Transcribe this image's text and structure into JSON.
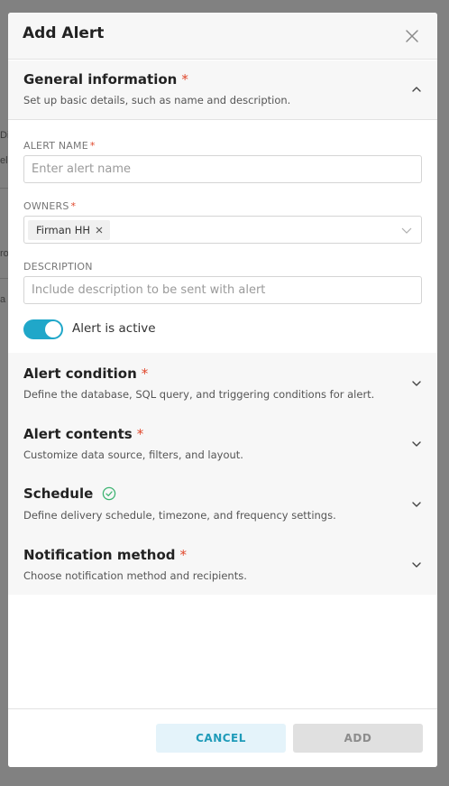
{
  "modal": {
    "title": "Add Alert",
    "close_icon": "close-icon"
  },
  "sections": {
    "general": {
      "title": "General information",
      "required_mark": "*",
      "subtitle": "Set up basic details, such as name and description.",
      "expanded": true
    },
    "condition": {
      "title": "Alert condition",
      "required_mark": "*",
      "subtitle": "Define the database, SQL query, and triggering conditions for alert."
    },
    "contents": {
      "title": "Alert contents",
      "required_mark": "*",
      "subtitle": "Customize data source, filters, and layout."
    },
    "schedule": {
      "title": "Schedule",
      "status_icon": "check-circle-icon",
      "subtitle": "Define delivery schedule, timezone, and frequency settings."
    },
    "notification": {
      "title": "Notification method",
      "required_mark": "*",
      "subtitle": "Choose notification method and recipients."
    }
  },
  "fields": {
    "alert_name": {
      "label": "ALERT NAME",
      "required_mark": "*",
      "value": "",
      "placeholder": "Enter alert name"
    },
    "owners": {
      "label": "OWNERS",
      "required_mark": "*",
      "selected": [
        "Firman HH"
      ]
    },
    "description": {
      "label": "DESCRIPTION",
      "value": "",
      "placeholder": "Include description to be sent with alert"
    },
    "active_toggle": {
      "label": "Alert is active",
      "on": true
    }
  },
  "footer": {
    "cancel_label": "CANCEL",
    "add_label": "ADD"
  },
  "background_fragments": [
    "Dil",
    "ele",
    "ro",
    "a"
  ],
  "colors": {
    "accent": "#20a7c9",
    "required": "#e0472b",
    "success": "#3cb371",
    "cancel_bg": "#e4f3fa",
    "add_disabled_bg": "#e0e0e0"
  }
}
